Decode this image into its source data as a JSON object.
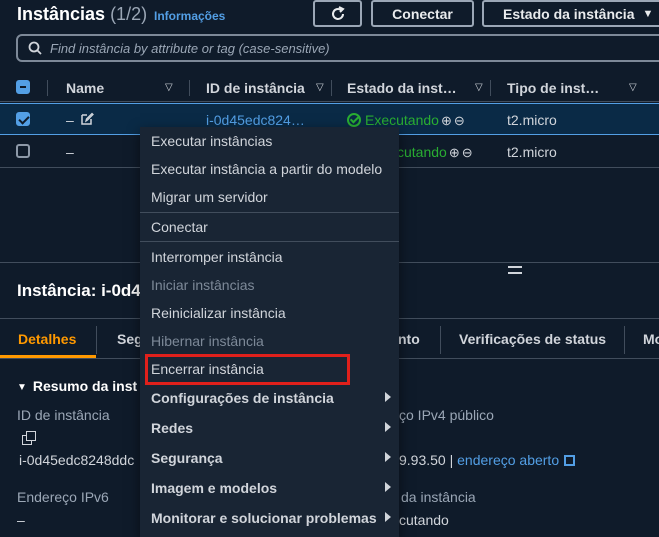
{
  "header": {
    "title": "Instâncias",
    "count": "(1/2)",
    "info_link": "Informações",
    "refresh_icon": "refresh-icon",
    "connect_label": "Conectar",
    "state_label": "Estado da instância"
  },
  "search": {
    "placeholder": "Find instância by attribute or tag (case-sensitive)"
  },
  "table": {
    "columns": [
      "Name",
      "ID de instância",
      "Estado da inst…",
      "Tipo de inst…"
    ],
    "rows": [
      {
        "selected": true,
        "name": "–",
        "id": "i-0d45edc824…",
        "state": "Executando",
        "type": "t2.micro"
      },
      {
        "selected": false,
        "name": "–",
        "id": "",
        "state": "cutando",
        "type": "t2.micro"
      }
    ]
  },
  "details": {
    "title": "Instância: i-0d4",
    "tabs": [
      "Detalhes",
      "Seg",
      "nto",
      "Verificações de status",
      "Mo"
    ],
    "section_title": "Resumo da inst",
    "instance_id_label": "ID de instância",
    "instance_id_value": "i-0d45edc8248ddc",
    "ipv6_label": "Endereço IPv6",
    "ipv6_value": "–",
    "ipv4_label": "ço IPv4 público",
    "ipv4_value": "9.93.50",
    "ipv4_separator": "|",
    "open_address_link": "endereço aberto",
    "state_label": "da instância",
    "state_value": "cutando"
  },
  "context_menu": {
    "items": [
      {
        "label": "Executar instâncias",
        "disabled": false
      },
      {
        "label": "Executar instância a partir do modelo",
        "disabled": false
      },
      {
        "label": "Migrar um servidor",
        "disabled": false
      },
      {
        "label": "Conectar",
        "disabled": false
      },
      {
        "label": "Interromper instância",
        "disabled": false
      },
      {
        "label": "Iniciar instâncias",
        "disabled": true
      },
      {
        "label": "Reinicializar instância",
        "disabled": false
      },
      {
        "label": "Hibernar instância",
        "disabled": true
      },
      {
        "label": "Encerrar instância",
        "disabled": false
      },
      {
        "label": "Configurações de instância",
        "submenu": true
      },
      {
        "label": "Redes",
        "submenu": true
      },
      {
        "label": "Segurança",
        "submenu": true
      },
      {
        "label": "Imagem e modelos",
        "submenu": true
      },
      {
        "label": "Monitorar e solucionar problemas",
        "submenu": true
      }
    ]
  },
  "colors": {
    "background": "#0f1b2a",
    "link": "#539fe5",
    "running": "#29ad32",
    "active_tab": "#ff9900",
    "highlight": "#e0201b"
  }
}
